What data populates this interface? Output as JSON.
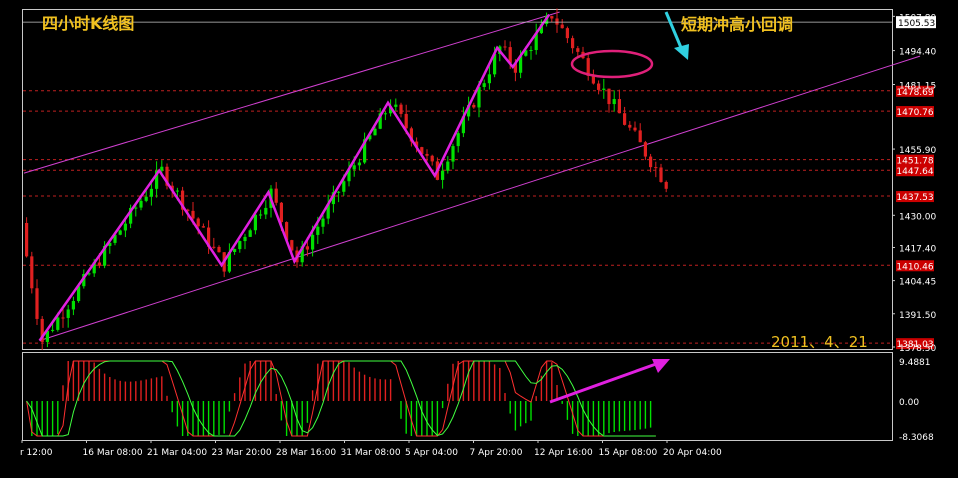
{
  "chart_data": [
    {
      "type": "candlestick",
      "title": "四小时K线图",
      "annotation_right": "短期冲高小回调",
      "date_label": "2011、4、21",
      "current_price": "1505.53",
      "ylim": [
        1378.5,
        1509.5
      ],
      "y_ticks": [
        "1507.80",
        "1494.40",
        "1481.15",
        "1455.90",
        "1430.00",
        "1417.40",
        "1404.45",
        "1391.50",
        "1378.50"
      ],
      "x_ticks": [
        "r 12:00",
        "16 Mar 08:00",
        "21 Mar 04:00",
        "23 Mar 20:00",
        "28 Mar 16:00",
        "31 Mar 08:00",
        "5 Apr 04:00",
        "7 Apr 20:00",
        "12 Apr 16:00",
        "15 Apr 08:00",
        "20 Apr 04:00"
      ],
      "horizontal_levels": [
        {
          "value": 1478.69,
          "label": "1478.69"
        },
        {
          "value": 1470.76,
          "label": "1470.76"
        },
        {
          "value": 1451.78,
          "label": "1451.78"
        },
        {
          "value": 1447.64,
          "label": "1447.64"
        },
        {
          "value": 1437.53,
          "label": "1437.53"
        },
        {
          "value": 1410.46,
          "label": "1410.46"
        },
        {
          "value": 1380.0,
          "label": "1381.03"
        }
      ],
      "zigzag": [
        {
          "bar": 3,
          "price": 1381.0
        },
        {
          "bar": 26,
          "price": 1447.5
        },
        {
          "bar": 38,
          "price": 1410.5
        },
        {
          "bar": 47,
          "price": 1439.0
        },
        {
          "bar": 52,
          "price": 1412.0
        },
        {
          "bar": 70,
          "price": 1474.0
        },
        {
          "bar": 79,
          "price": 1445.5
        },
        {
          "bar": 91,
          "price": 1495.5
        },
        {
          "bar": 94,
          "price": 1488.0
        },
        {
          "bar": 101,
          "price": 1508.5
        }
      ],
      "channel_upper": [
        {
          "bar": 0,
          "price": 1446.5
        },
        {
          "bar": 103,
          "price": 1509.5
        }
      ],
      "channel_lower": [
        {
          "bar": 3,
          "price": 1381.0
        },
        {
          "bar": 143,
          "price": 1473.0
        }
      ]
    },
    {
      "type": "macd",
      "y_ticks": [
        "9.4881",
        "0.00",
        "-8.3068"
      ],
      "ylim": [
        -8.3068,
        9.4881
      ]
    }
  ],
  "colors": {
    "background": "#000000",
    "bull": "#00e000",
    "bear": "#e02020",
    "zigzag": "#e020e0",
    "channel": "#d040d0",
    "level_line": "#c02020",
    "level_tag": "#cc0000",
    "title": "#f0c020",
    "arrow": "#30d0e0",
    "date": "#f0c020"
  }
}
